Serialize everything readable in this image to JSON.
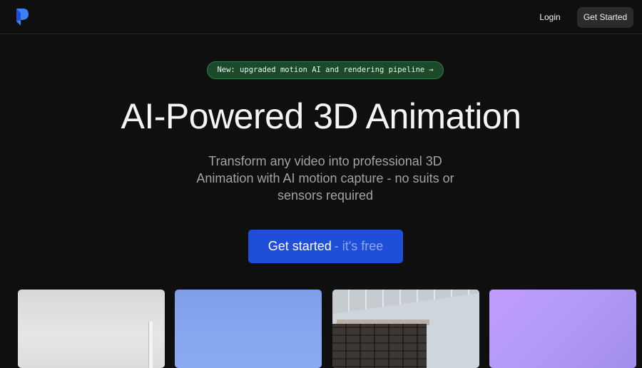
{
  "nav": {
    "logo_icon": "brand-logo-icon",
    "login_label": "Login",
    "cta_label": "Get Started"
  },
  "announcement": {
    "text": "New: upgraded motion AI and rendering pipeline",
    "arrow": "→"
  },
  "hero": {
    "title": "AI-Powered 3D Animation",
    "subtitle": "Transform any video into professional 3D Animation with AI motion capture - no suits or sensors required",
    "cta_main": "Get started",
    "cta_sub": "- it's free"
  },
  "colors": {
    "background": "#0f0f0f",
    "accent_blue": "#1f4fd8",
    "announce_green": "#1a4a2a"
  },
  "gallery": [
    "preview-image-1",
    "preview-image-2",
    "preview-image-3",
    "preview-image-4"
  ]
}
